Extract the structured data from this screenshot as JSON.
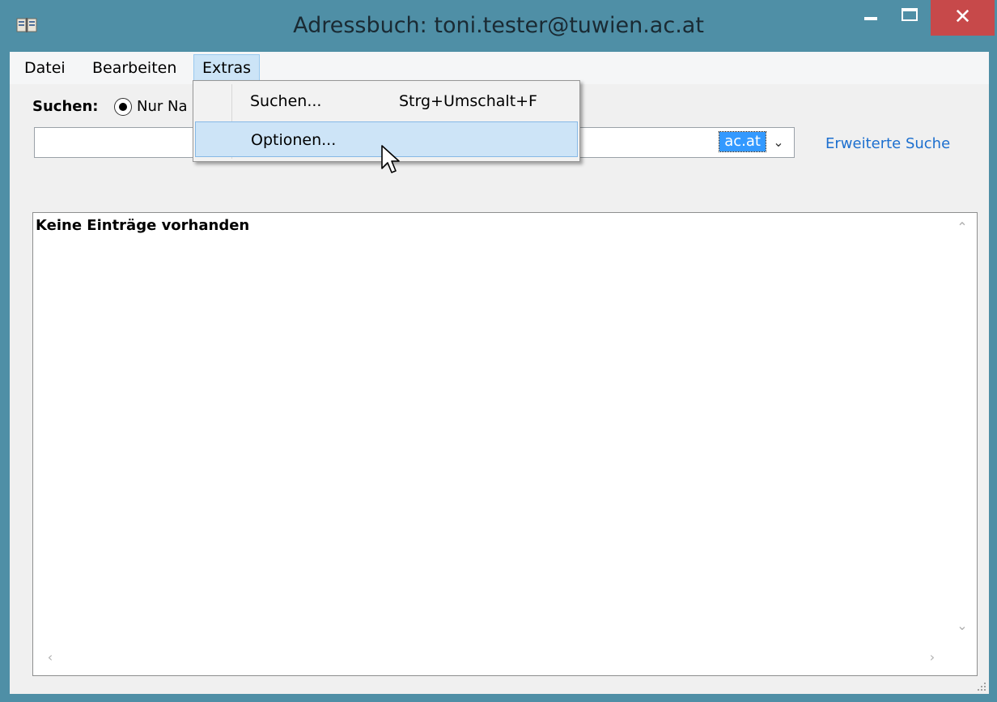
{
  "window": {
    "title": "Adressbuch: toni.tester@tuwien.ac.at",
    "icon": "address-book-icon",
    "controls": {
      "minimize": "minimize-icon",
      "maximize": "maximize-icon",
      "close": "close-icon",
      "close_glyph": "✕"
    },
    "accent_color": "#4f8fa6",
    "close_color": "#c7494a"
  },
  "menubar": {
    "items": [
      {
        "label": "Datei"
      },
      {
        "label": "Bearbeiten"
      },
      {
        "label": "Extras",
        "open": true
      }
    ]
  },
  "extras_menu": {
    "items": [
      {
        "label": "Suchen...",
        "shortcut": "Strg+Umschalt+F"
      },
      {
        "label": "Optionen...",
        "highlighted": true
      }
    ]
  },
  "search": {
    "label": "Suchen:",
    "radio_label": "Nur Na",
    "radio_selected": true,
    "input_value": "",
    "directory_value": "ac.at",
    "directory_arrow": "⌄",
    "advanced_link": "Erweiterte Suche"
  },
  "results": {
    "empty_message": "Keine Einträge vorhanden",
    "scroll_up": "⌃",
    "scroll_down": "⌄",
    "scroll_left": "‹",
    "scroll_right": "›"
  },
  "cursor": "arrow-cursor-icon"
}
